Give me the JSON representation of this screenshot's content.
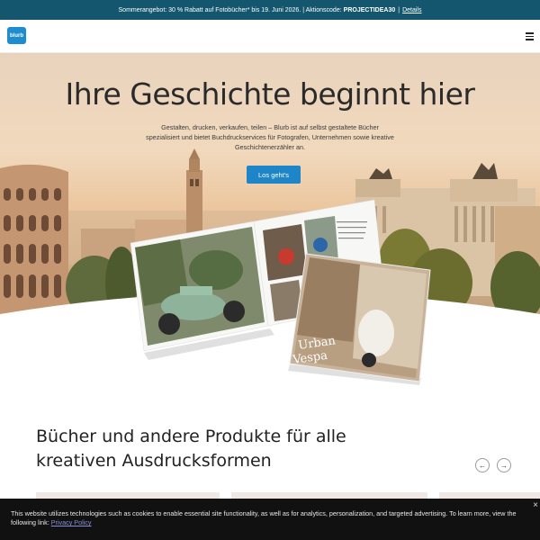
{
  "promo": {
    "text": "Sommerangebot: 30 % Rabatt auf Fotobücher* bis 19. Juni 2026. | Aktionscode:",
    "code": "PROJECTIDEA30",
    "separator": "|",
    "link": "Details"
  },
  "header": {
    "logo_text": "blurb",
    "menu_icon": "hamburger-menu-icon"
  },
  "hero": {
    "title": "Ihre Geschichte beginnt hier",
    "subtitle": "Gestalten, drucken, verkaufen, teilen – Blurb ist auf selbst gestaltete Bücher spezialisiert und bietet Buchdruckservices für Fotografen, Unternehmen sowie kreative Geschichtenerzähler an.",
    "cta_label": "Los geht's",
    "book_cover_title_line1": "Urban",
    "book_cover_title_line2": "Vespa"
  },
  "products": {
    "title_line1": "Bücher und andere Produkte für alle",
    "title_line2": "kreativen Ausdrucksformen",
    "prev_icon": "arrow-left-icon",
    "next_icon": "arrow-right-icon",
    "prev_glyph": "←",
    "next_glyph": "→"
  },
  "cookie": {
    "text": "This website utilizes technologies such as cookies to enable essential site functionality, as well as for analytics, personalization, and targeted advertising. To learn more, view the following link:",
    "link": "Privacy Policy",
    "close": "×"
  },
  "colors": {
    "promo_bg": "#14566e",
    "brand_blue": "#1e86c8",
    "cookie_bg": "#111111"
  }
}
